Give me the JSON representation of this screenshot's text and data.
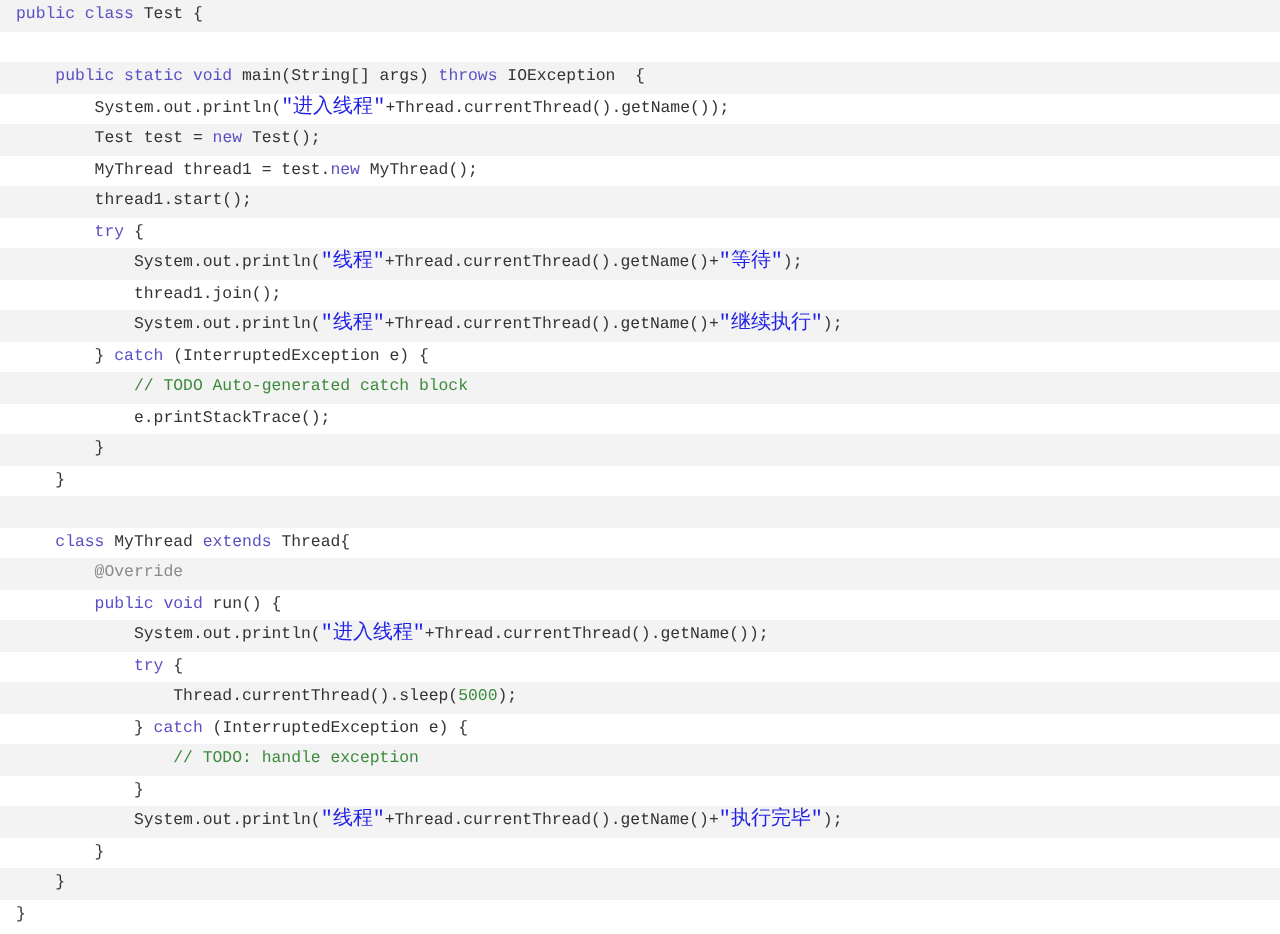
{
  "code_lines": [
    {
      "kind": "code",
      "tokens": [
        {
          "kind": "keyword",
          "text": "public class"
        },
        {
          "kind": "plain",
          "text": " Test {"
        }
      ]
    },
    {
      "kind": "blank"
    },
    {
      "kind": "code",
      "tokens": [
        {
          "kind": "keyword",
          "text": "    public static void"
        },
        {
          "kind": "plain",
          "text": " main(String[] args) "
        },
        {
          "kind": "keyword",
          "text": "throws"
        },
        {
          "kind": "plain",
          "text": " IOException  {"
        }
      ]
    },
    {
      "kind": "code",
      "tokens": [
        {
          "kind": "plain",
          "text": "        System.out.println("
        },
        {
          "kind": "string",
          "text": "\"进入线程\""
        },
        {
          "kind": "plain",
          "text": "+Thread.currentThread().getName());"
        }
      ]
    },
    {
      "kind": "code",
      "tokens": [
        {
          "kind": "plain",
          "text": "        Test test = "
        },
        {
          "kind": "keyword",
          "text": "new"
        },
        {
          "kind": "plain",
          "text": " Test();"
        }
      ]
    },
    {
      "kind": "code",
      "tokens": [
        {
          "kind": "plain",
          "text": "        MyThread thread1 = test."
        },
        {
          "kind": "keyword",
          "text": "new"
        },
        {
          "kind": "plain",
          "text": " MyThread();"
        }
      ]
    },
    {
      "kind": "code",
      "tokens": [
        {
          "kind": "plain",
          "text": "        thread1.start();"
        }
      ]
    },
    {
      "kind": "code",
      "tokens": [
        {
          "kind": "keyword",
          "text": "        try"
        },
        {
          "kind": "plain",
          "text": " {"
        }
      ]
    },
    {
      "kind": "code",
      "tokens": [
        {
          "kind": "plain",
          "text": "            System.out.println("
        },
        {
          "kind": "string",
          "text": "\"线程\""
        },
        {
          "kind": "plain",
          "text": "+Thread.currentThread().getName()+"
        },
        {
          "kind": "string",
          "text": "\"等待\""
        },
        {
          "kind": "plain",
          "text": ");"
        }
      ]
    },
    {
      "kind": "code",
      "tokens": [
        {
          "kind": "plain",
          "text": "            thread1.join();"
        }
      ]
    },
    {
      "kind": "code",
      "tokens": [
        {
          "kind": "plain",
          "text": "            System.out.println("
        },
        {
          "kind": "string",
          "text": "\"线程\""
        },
        {
          "kind": "plain",
          "text": "+Thread.currentThread().getName()+"
        },
        {
          "kind": "string",
          "text": "\"继续执行\""
        },
        {
          "kind": "plain",
          "text": ");"
        }
      ]
    },
    {
      "kind": "code",
      "tokens": [
        {
          "kind": "plain",
          "text": "        } "
        },
        {
          "kind": "keyword",
          "text": "catch"
        },
        {
          "kind": "plain",
          "text": " (InterruptedException e) {"
        }
      ]
    },
    {
      "kind": "code",
      "tokens": [
        {
          "kind": "comment",
          "text": "            // TODO Auto-generated catch block"
        }
      ]
    },
    {
      "kind": "code",
      "tokens": [
        {
          "kind": "plain",
          "text": "            e.printStackTrace();"
        }
      ]
    },
    {
      "kind": "code",
      "tokens": [
        {
          "kind": "plain",
          "text": "        }"
        }
      ]
    },
    {
      "kind": "code",
      "tokens": [
        {
          "kind": "plain",
          "text": "    }"
        }
      ]
    },
    {
      "kind": "blank"
    },
    {
      "kind": "code",
      "tokens": [
        {
          "kind": "keyword",
          "text": "    class"
        },
        {
          "kind": "plain",
          "text": " MyThread "
        },
        {
          "kind": "keyword",
          "text": "extends"
        },
        {
          "kind": "plain",
          "text": " Thread{"
        }
      ]
    },
    {
      "kind": "code",
      "tokens": [
        {
          "kind": "annotation",
          "text": "        @Override"
        }
      ]
    },
    {
      "kind": "code",
      "tokens": [
        {
          "kind": "keyword",
          "text": "        public void"
        },
        {
          "kind": "plain",
          "text": " run() {"
        }
      ]
    },
    {
      "kind": "code",
      "tokens": [
        {
          "kind": "plain",
          "text": "            System.out.println("
        },
        {
          "kind": "string",
          "text": "\"进入线程\""
        },
        {
          "kind": "plain",
          "text": "+Thread.currentThread().getName());"
        }
      ]
    },
    {
      "kind": "code",
      "tokens": [
        {
          "kind": "keyword",
          "text": "            try"
        },
        {
          "kind": "plain",
          "text": " {"
        }
      ]
    },
    {
      "kind": "code",
      "tokens": [
        {
          "kind": "plain",
          "text": "                Thread.currentThread().sleep("
        },
        {
          "kind": "number",
          "text": "5000"
        },
        {
          "kind": "plain",
          "text": ");"
        }
      ]
    },
    {
      "kind": "code",
      "tokens": [
        {
          "kind": "plain",
          "text": "            } "
        },
        {
          "kind": "keyword",
          "text": "catch"
        },
        {
          "kind": "plain",
          "text": " (InterruptedException e) {"
        }
      ]
    },
    {
      "kind": "code",
      "tokens": [
        {
          "kind": "comment",
          "text": "                // TODO: handle exception"
        }
      ]
    },
    {
      "kind": "code",
      "tokens": [
        {
          "kind": "plain",
          "text": "            }"
        }
      ]
    },
    {
      "kind": "code",
      "tokens": [
        {
          "kind": "plain",
          "text": "            System.out.println("
        },
        {
          "kind": "string",
          "text": "\"线程\""
        },
        {
          "kind": "plain",
          "text": "+Thread.currentThread().getName()+"
        },
        {
          "kind": "string",
          "text": "\"执行完毕\""
        },
        {
          "kind": "plain",
          "text": ");"
        }
      ]
    },
    {
      "kind": "code",
      "tokens": [
        {
          "kind": "plain",
          "text": "        }"
        }
      ]
    },
    {
      "kind": "code",
      "tokens": [
        {
          "kind": "plain",
          "text": "    }"
        }
      ]
    },
    {
      "kind": "code",
      "tokens": [
        {
          "kind": "plain",
          "text": "}"
        }
      ]
    }
  ]
}
